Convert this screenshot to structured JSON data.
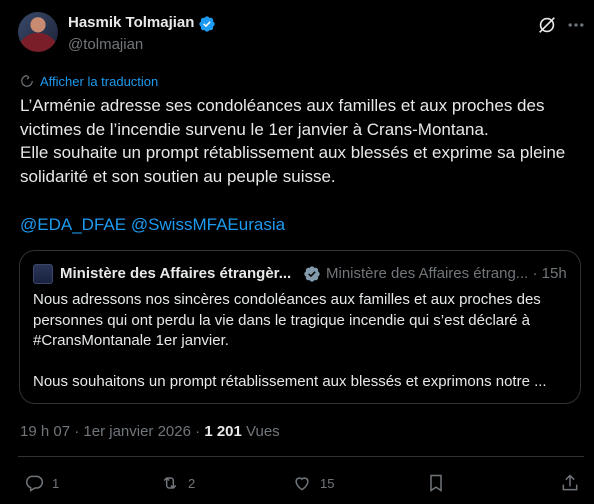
{
  "author": {
    "name": "Hasmik Tolmajian",
    "handle": "@tolmajian"
  },
  "translate_label": "Afficher la traduction",
  "body": {
    "line1": "L’Arménie adresse ses condoléances aux familles et aux proches des victimes de l’incendie survenu le 1er janvier à Crans-Montana.",
    "line2": "Elle souhaite un prompt rétablissement aux blessés et exprime sa pleine solidarité et son soutien au peuple suisse."
  },
  "mentions": [
    "@EDA_DFAE",
    "@SwissMFAEurasia"
  ],
  "quote": {
    "name": "Ministère des Affaires étrangèr...",
    "handle": "Ministère des Affaires étrang...",
    "separator": "·",
    "time": "15h",
    "line1": "Nous adressons nos sincères condoléances aux familles et aux proches des personnes qui ont perdu la vie dans le tragique incendie qui s’est déclaré à #CransMontanale 1er janvier.",
    "line2": "Nous souhaitons un prompt rétablissement aux blessés et exprimons notre ..."
  },
  "meta": {
    "time": "19 h 07",
    "separator": "·",
    "date": "1er janvier 2026",
    "views_count": "1 201",
    "views_label": "Vues"
  },
  "actions": {
    "replies": "1",
    "reposts": "2",
    "likes": "15"
  },
  "colors": {
    "background": "#000000",
    "text": "#e7e9ea",
    "muted": "#71767b",
    "link": "#1d9bf0",
    "border": "#2f3336"
  }
}
